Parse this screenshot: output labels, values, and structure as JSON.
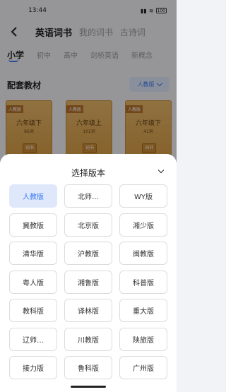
{
  "status_bar": {
    "time": "13:44",
    "battery": "100"
  },
  "header": {
    "tabs": [
      {
        "label": "英语词书",
        "active": true
      },
      {
        "label": "我的词书",
        "active": false
      },
      {
        "label": "古诗词",
        "active": false
      }
    ]
  },
  "level_tabs": [
    {
      "label": "小学",
      "active": true
    },
    {
      "label": "初中",
      "active": false
    },
    {
      "label": "高中",
      "active": false
    },
    {
      "label": "剑桥英语",
      "active": false
    },
    {
      "label": "新概念",
      "active": false
    }
  ],
  "section": {
    "title": "配套教材",
    "version_selected": "人教版"
  },
  "books": [
    {
      "publisher": "人教版",
      "grade": "六年级下",
      "count": "86词",
      "badge": "词书"
    },
    {
      "publisher": "人教版",
      "grade": "六年级上",
      "count": "101词",
      "badge": "词书"
    },
    {
      "publisher": "人教版",
      "grade": "六年级下",
      "count": "41词",
      "badge": "词书"
    }
  ],
  "sheet": {
    "title": "选择版本",
    "options": [
      {
        "label": "人教版",
        "selected": true
      },
      {
        "label": "北师…",
        "selected": false
      },
      {
        "label": "WY版",
        "selected": false
      },
      {
        "label": "冀教版",
        "selected": false
      },
      {
        "label": "北京版",
        "selected": false
      },
      {
        "label": "湘少版",
        "selected": false
      },
      {
        "label": "清华版",
        "selected": false
      },
      {
        "label": "沪教版",
        "selected": false
      },
      {
        "label": "闽教版",
        "selected": false
      },
      {
        "label": "粤人版",
        "selected": false
      },
      {
        "label": "湘鲁版",
        "selected": false
      },
      {
        "label": "科普版",
        "selected": false
      },
      {
        "label": "教科版",
        "selected": false
      },
      {
        "label": "译林版",
        "selected": false
      },
      {
        "label": "重大版",
        "selected": false
      },
      {
        "label": "辽师…",
        "selected": false
      },
      {
        "label": "川教版",
        "selected": false
      },
      {
        "label": "陕旅版",
        "selected": false
      },
      {
        "label": "接力版",
        "selected": false
      },
      {
        "label": "鲁科版",
        "selected": false
      },
      {
        "label": "广州版",
        "selected": false
      }
    ]
  },
  "colors": {
    "accent": "#3b7cf0",
    "selected_bg": "#dfe8fb",
    "book": "#e0a955"
  },
  "icons": {
    "back": "back-arrow-icon",
    "collapse": "chevron-down-icon",
    "dropdown": "chevron-down-icon"
  }
}
